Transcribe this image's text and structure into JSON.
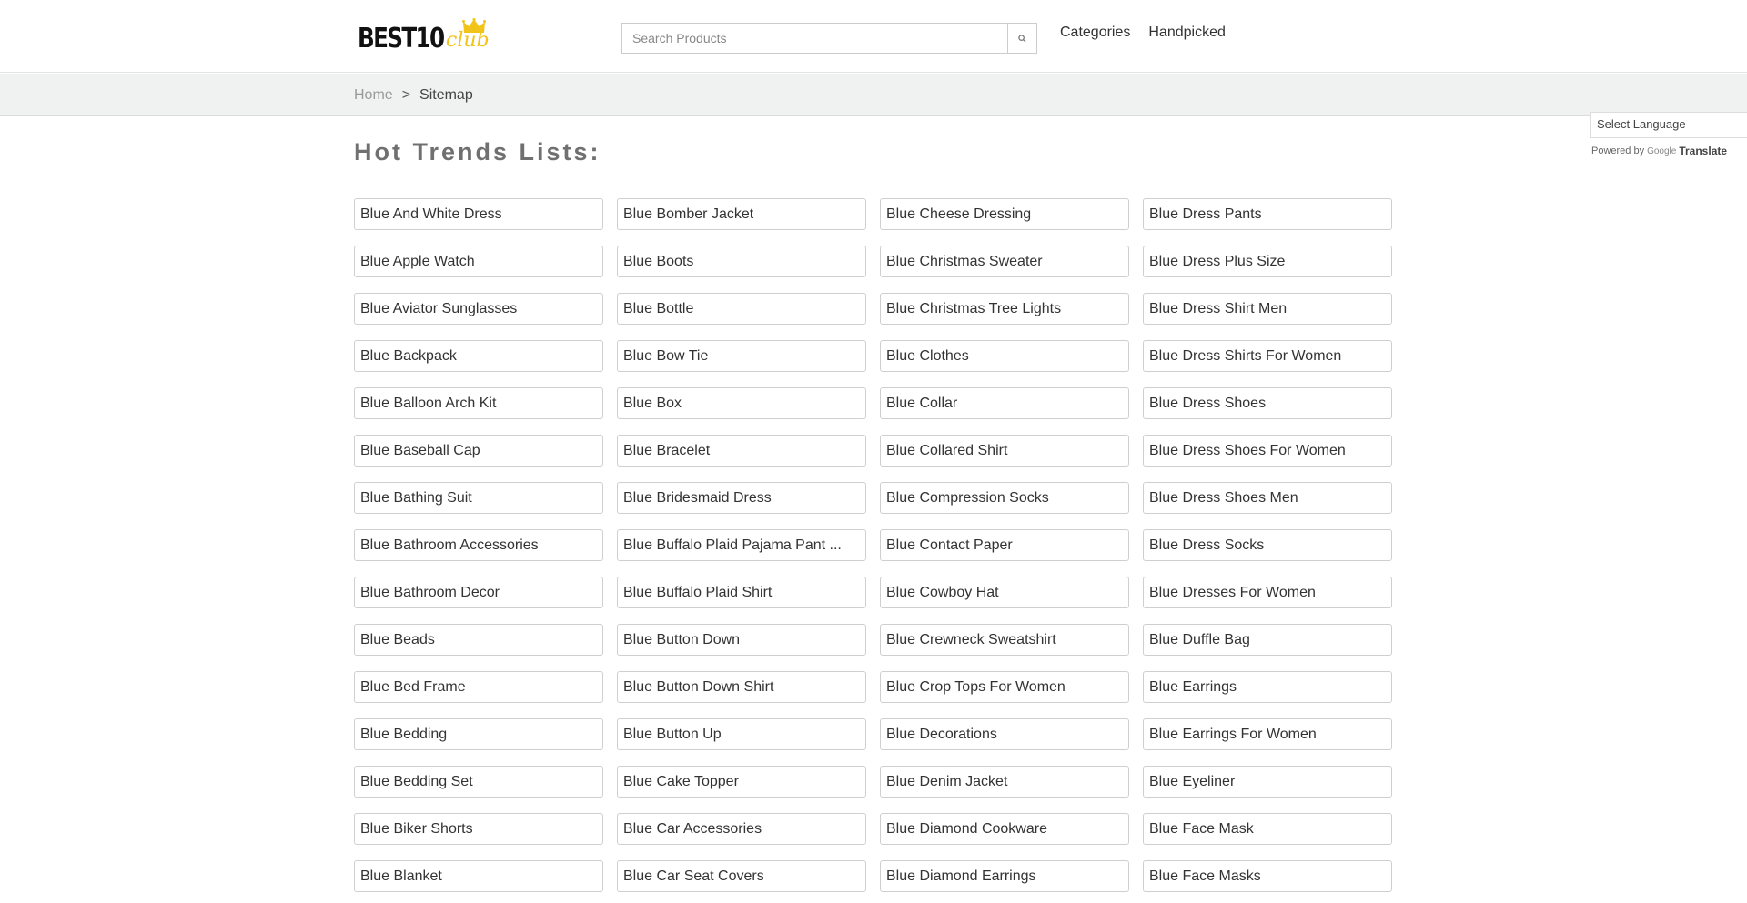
{
  "header": {
    "logo": {
      "text_main": "BEST10",
      "text_accent": "club",
      "accent_color": "#f2c318",
      "crown_icon": "crown-icon"
    },
    "search": {
      "placeholder": "Search Products",
      "value": "",
      "button_icon": "search-icon"
    },
    "nav": [
      {
        "label": "Categories"
      },
      {
        "label": "Handpicked"
      }
    ]
  },
  "breadcrumb": {
    "home": "Home",
    "separator": ">",
    "current": "Sitemap"
  },
  "translate": {
    "select_label": "Select Language",
    "powered_by": "Powered by",
    "google": "Google",
    "translate": "Translate"
  },
  "page_title": "Hot Trends Lists:",
  "items": [
    "Blue And White Dress",
    "Blue Bomber Jacket",
    "Blue Cheese Dressing",
    "Blue Dress Pants",
    "Blue Apple Watch",
    "Blue Boots",
    "Blue Christmas Sweater",
    "Blue Dress Plus Size",
    "Blue Aviator Sunglasses",
    "Blue Bottle",
    "Blue Christmas Tree Lights",
    "Blue Dress Shirt Men",
    "Blue Backpack",
    "Blue Bow Tie",
    "Blue Clothes",
    "Blue Dress Shirts For Women",
    "Blue Balloon Arch Kit",
    "Blue Box",
    "Blue Collar",
    "Blue Dress Shoes",
    "Blue Baseball Cap",
    "Blue Bracelet",
    "Blue Collared Shirt",
    "Blue Dress Shoes For Women",
    "Blue Bathing Suit",
    "Blue Bridesmaid Dress",
    "Blue Compression Socks",
    "Blue Dress Shoes Men",
    "Blue Bathroom Accessories",
    "Blue Buffalo Plaid Pajama Pant ...",
    "Blue Contact Paper",
    "Blue Dress Socks",
    "Blue Bathroom Decor",
    "Blue Buffalo Plaid Shirt",
    "Blue Cowboy Hat",
    "Blue Dresses For Women",
    "Blue Beads",
    "Blue Button Down",
    "Blue Crewneck Sweatshirt",
    "Blue Duffle Bag",
    "Blue Bed Frame",
    "Blue Button Down Shirt",
    "Blue Crop Tops For Women",
    "Blue Earrings",
    "Blue Bedding",
    "Blue Button Up",
    "Blue Decorations",
    "Blue Earrings For Women",
    "Blue Bedding Set",
    "Blue Cake Topper",
    "Blue Denim Jacket",
    "Blue Eyeliner",
    "Blue Biker Shorts",
    "Blue Car Accessories",
    "Blue Diamond Cookware",
    "Blue Face Mask",
    "Blue Blanket",
    "Blue Car Seat Covers",
    "Blue Diamond Earrings",
    "Blue Face Masks"
  ]
}
